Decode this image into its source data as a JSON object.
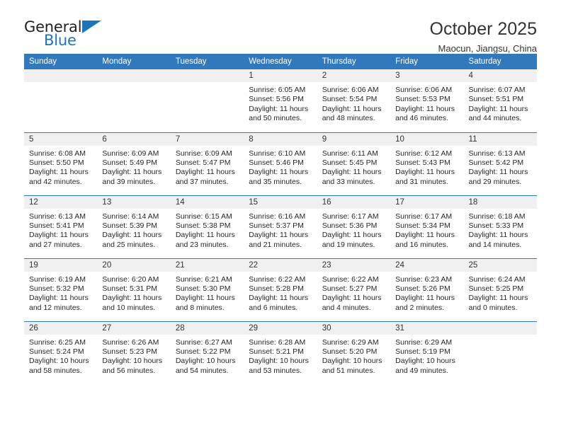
{
  "brand": {
    "name_part1": "General",
    "name_part2": "Blue",
    "triangle_color": "#1b75bb"
  },
  "header": {
    "title": "October 2025",
    "subtitle": "Maocun, Jiangsu, China"
  },
  "theme": {
    "header_row_bg": "#3179bc",
    "daynum_bg": "#f0f0f0",
    "rule_color": "#3179bc",
    "text_color": "#262626"
  },
  "weekdays": [
    "Sunday",
    "Monday",
    "Tuesday",
    "Wednesday",
    "Thursday",
    "Friday",
    "Saturday"
  ],
  "weeks": [
    [
      {
        "day": "",
        "sunrise": "",
        "sunset": "",
        "daylight": ""
      },
      {
        "day": "",
        "sunrise": "",
        "sunset": "",
        "daylight": ""
      },
      {
        "day": "",
        "sunrise": "",
        "sunset": "",
        "daylight": ""
      },
      {
        "day": "1",
        "sunrise": "Sunrise: 6:05 AM",
        "sunset": "Sunset: 5:56 PM",
        "daylight": "Daylight: 11 hours and 50 minutes."
      },
      {
        "day": "2",
        "sunrise": "Sunrise: 6:06 AM",
        "sunset": "Sunset: 5:54 PM",
        "daylight": "Daylight: 11 hours and 48 minutes."
      },
      {
        "day": "3",
        "sunrise": "Sunrise: 6:06 AM",
        "sunset": "Sunset: 5:53 PM",
        "daylight": "Daylight: 11 hours and 46 minutes."
      },
      {
        "day": "4",
        "sunrise": "Sunrise: 6:07 AM",
        "sunset": "Sunset: 5:51 PM",
        "daylight": "Daylight: 11 hours and 44 minutes."
      }
    ],
    [
      {
        "day": "5",
        "sunrise": "Sunrise: 6:08 AM",
        "sunset": "Sunset: 5:50 PM",
        "daylight": "Daylight: 11 hours and 42 minutes."
      },
      {
        "day": "6",
        "sunrise": "Sunrise: 6:09 AM",
        "sunset": "Sunset: 5:49 PM",
        "daylight": "Daylight: 11 hours and 39 minutes."
      },
      {
        "day": "7",
        "sunrise": "Sunrise: 6:09 AM",
        "sunset": "Sunset: 5:47 PM",
        "daylight": "Daylight: 11 hours and 37 minutes."
      },
      {
        "day": "8",
        "sunrise": "Sunrise: 6:10 AM",
        "sunset": "Sunset: 5:46 PM",
        "daylight": "Daylight: 11 hours and 35 minutes."
      },
      {
        "day": "9",
        "sunrise": "Sunrise: 6:11 AM",
        "sunset": "Sunset: 5:45 PM",
        "daylight": "Daylight: 11 hours and 33 minutes."
      },
      {
        "day": "10",
        "sunrise": "Sunrise: 6:12 AM",
        "sunset": "Sunset: 5:43 PM",
        "daylight": "Daylight: 11 hours and 31 minutes."
      },
      {
        "day": "11",
        "sunrise": "Sunrise: 6:13 AM",
        "sunset": "Sunset: 5:42 PM",
        "daylight": "Daylight: 11 hours and 29 minutes."
      }
    ],
    [
      {
        "day": "12",
        "sunrise": "Sunrise: 6:13 AM",
        "sunset": "Sunset: 5:41 PM",
        "daylight": "Daylight: 11 hours and 27 minutes."
      },
      {
        "day": "13",
        "sunrise": "Sunrise: 6:14 AM",
        "sunset": "Sunset: 5:39 PM",
        "daylight": "Daylight: 11 hours and 25 minutes."
      },
      {
        "day": "14",
        "sunrise": "Sunrise: 6:15 AM",
        "sunset": "Sunset: 5:38 PM",
        "daylight": "Daylight: 11 hours and 23 minutes."
      },
      {
        "day": "15",
        "sunrise": "Sunrise: 6:16 AM",
        "sunset": "Sunset: 5:37 PM",
        "daylight": "Daylight: 11 hours and 21 minutes."
      },
      {
        "day": "16",
        "sunrise": "Sunrise: 6:17 AM",
        "sunset": "Sunset: 5:36 PM",
        "daylight": "Daylight: 11 hours and 19 minutes."
      },
      {
        "day": "17",
        "sunrise": "Sunrise: 6:17 AM",
        "sunset": "Sunset: 5:34 PM",
        "daylight": "Daylight: 11 hours and 16 minutes."
      },
      {
        "day": "18",
        "sunrise": "Sunrise: 6:18 AM",
        "sunset": "Sunset: 5:33 PM",
        "daylight": "Daylight: 11 hours and 14 minutes."
      }
    ],
    [
      {
        "day": "19",
        "sunrise": "Sunrise: 6:19 AM",
        "sunset": "Sunset: 5:32 PM",
        "daylight": "Daylight: 11 hours and 12 minutes."
      },
      {
        "day": "20",
        "sunrise": "Sunrise: 6:20 AM",
        "sunset": "Sunset: 5:31 PM",
        "daylight": "Daylight: 11 hours and 10 minutes."
      },
      {
        "day": "21",
        "sunrise": "Sunrise: 6:21 AM",
        "sunset": "Sunset: 5:30 PM",
        "daylight": "Daylight: 11 hours and 8 minutes."
      },
      {
        "day": "22",
        "sunrise": "Sunrise: 6:22 AM",
        "sunset": "Sunset: 5:28 PM",
        "daylight": "Daylight: 11 hours and 6 minutes."
      },
      {
        "day": "23",
        "sunrise": "Sunrise: 6:22 AM",
        "sunset": "Sunset: 5:27 PM",
        "daylight": "Daylight: 11 hours and 4 minutes."
      },
      {
        "day": "24",
        "sunrise": "Sunrise: 6:23 AM",
        "sunset": "Sunset: 5:26 PM",
        "daylight": "Daylight: 11 hours and 2 minutes."
      },
      {
        "day": "25",
        "sunrise": "Sunrise: 6:24 AM",
        "sunset": "Sunset: 5:25 PM",
        "daylight": "Daylight: 11 hours and 0 minutes."
      }
    ],
    [
      {
        "day": "26",
        "sunrise": "Sunrise: 6:25 AM",
        "sunset": "Sunset: 5:24 PM",
        "daylight": "Daylight: 10 hours and 58 minutes."
      },
      {
        "day": "27",
        "sunrise": "Sunrise: 6:26 AM",
        "sunset": "Sunset: 5:23 PM",
        "daylight": "Daylight: 10 hours and 56 minutes."
      },
      {
        "day": "28",
        "sunrise": "Sunrise: 6:27 AM",
        "sunset": "Sunset: 5:22 PM",
        "daylight": "Daylight: 10 hours and 54 minutes."
      },
      {
        "day": "29",
        "sunrise": "Sunrise: 6:28 AM",
        "sunset": "Sunset: 5:21 PM",
        "daylight": "Daylight: 10 hours and 53 minutes."
      },
      {
        "day": "30",
        "sunrise": "Sunrise: 6:29 AM",
        "sunset": "Sunset: 5:20 PM",
        "daylight": "Daylight: 10 hours and 51 minutes."
      },
      {
        "day": "31",
        "sunrise": "Sunrise: 6:29 AM",
        "sunset": "Sunset: 5:19 PM",
        "daylight": "Daylight: 10 hours and 49 minutes."
      },
      {
        "day": "",
        "sunrise": "",
        "sunset": "",
        "daylight": ""
      }
    ]
  ]
}
